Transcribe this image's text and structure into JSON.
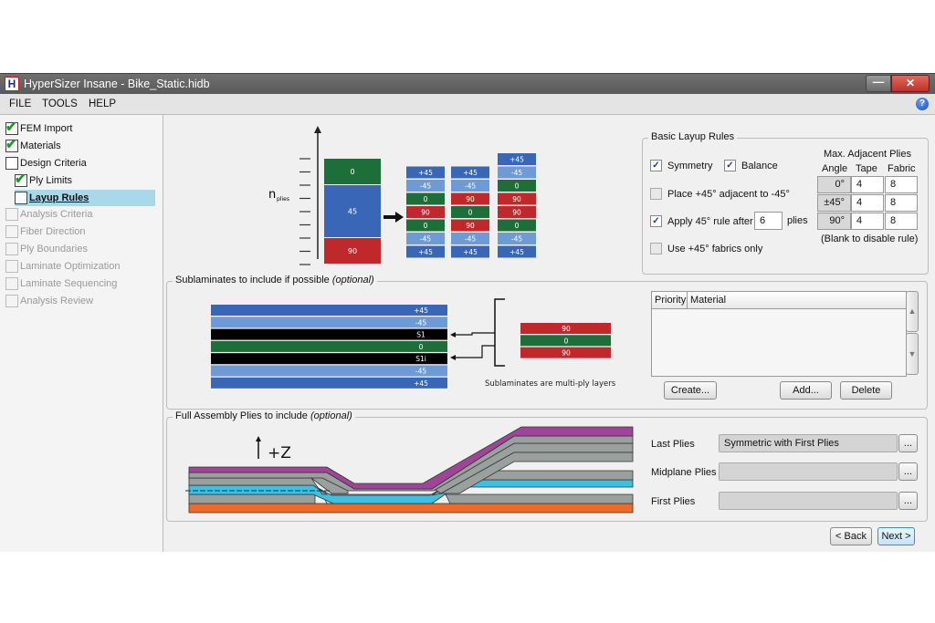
{
  "window": {
    "app_icon_letter": "H",
    "title": "HyperSizer Insane - Bike_Static.hidb",
    "min_glyph": "—",
    "close_glyph": "✕",
    "help_glyph": "?"
  },
  "menu": [
    "FILE",
    "TOOLS",
    "HELP"
  ],
  "sidebar": {
    "items": [
      {
        "label": "FEM Import",
        "checked": true,
        "enabled": true
      },
      {
        "label": "Materials",
        "checked": true,
        "enabled": true
      },
      {
        "label": "Design Criteria",
        "checked": false,
        "enabled": true
      },
      {
        "label": "Ply Limits",
        "checked": true,
        "enabled": true
      },
      {
        "label": "Layup Rules",
        "checked": false,
        "enabled": true,
        "selected": true
      },
      {
        "label": "Analysis Criteria",
        "checked": false,
        "enabled": false
      },
      {
        "label": "Fiber Direction",
        "checked": false,
        "enabled": false
      },
      {
        "label": "Ply Boundaries",
        "checked": false,
        "enabled": false
      },
      {
        "label": "Laminate Optimization",
        "checked": false,
        "enabled": false
      },
      {
        "label": "Laminate Sequencing",
        "checked": false,
        "enabled": false
      },
      {
        "label": "Analysis Review",
        "checked": false,
        "enabled": false
      }
    ]
  },
  "diagram_top": {
    "axis_label": "n",
    "axis_sub": "plies",
    "blocks": [
      {
        "label": "0",
        "color": "#1e6e3a"
      },
      {
        "label": "45",
        "color": "#3a66b8"
      },
      {
        "label": "90",
        "color": "#c0282c"
      }
    ],
    "stacks": [
      [
        "+45",
        "-45",
        "0",
        "90",
        "0",
        "-45",
        "+45"
      ],
      [
        "+45",
        "-45",
        "90",
        "0",
        "90",
        "-45",
        "+45"
      ],
      [
        "+45",
        "-45",
        "0",
        "90",
        "90",
        "0",
        "-45",
        "+45"
      ]
    ]
  },
  "colors": {
    "+45": "#3a66b8",
    "-45": "#6e9ad6",
    "0": "#1e6e3a",
    "90": "#c0282c",
    "S1": "#000000",
    "S1i": "#000000",
    "selected_nav": "#a8d8ea",
    "check": "#1a9a2a"
  },
  "basic_rules": {
    "legend": "Basic Layup Rules",
    "symmetry": {
      "label": "Symmetry",
      "checked": true
    },
    "balance": {
      "label": "Balance",
      "checked": true
    },
    "adjacent": {
      "label": "Place +45° adjacent to -45°",
      "checked": false
    },
    "apply45": {
      "label": "Apply 45° rule after",
      "checked": true,
      "value": "6",
      "suffix": "plies"
    },
    "fabrics_only": {
      "label": "Use +45° fabrics only",
      "checked": false
    },
    "max_adjacent": {
      "title": "Max. Adjacent Plies",
      "headers": [
        "Angle",
        "Tape",
        "Fabric"
      ],
      "rows": [
        {
          "angle": "0°",
          "tape": "4",
          "fabric": "8"
        },
        {
          "angle": "±45°",
          "tape": "4",
          "fabric": "8"
        },
        {
          "angle": "90°",
          "tape": "4",
          "fabric": "8"
        }
      ],
      "note": "(Blank to disable rule)"
    }
  },
  "sublaminates": {
    "legend": "Sublaminates to include if possible",
    "legend_opt": "(optional)",
    "stack": [
      "+45",
      "-45",
      "S1",
      "0",
      "S1i",
      "-45",
      "+45"
    ],
    "sub": [
      "90",
      "0",
      "90"
    ],
    "caption": "Sublaminates are multi-ply layers",
    "table_headers": [
      "Priority",
      "Material"
    ],
    "buttons": {
      "create": "Create...",
      "add": "Add...",
      "delete": "Delete"
    },
    "scroll_up": "▲",
    "scroll_down": "▼"
  },
  "assembly": {
    "legend": "Full Assembly Plies to include",
    "legend_opt": "(optional)",
    "z_label": "+Z",
    "fields": [
      {
        "label": "Last Plies",
        "value": "Symmetric with First Plies"
      },
      {
        "label": "Midplane Plies",
        "value": ""
      },
      {
        "label": "First Plies",
        "value": ""
      }
    ],
    "browse": "..."
  },
  "footer": {
    "back": "< Back",
    "next": "Next >"
  }
}
